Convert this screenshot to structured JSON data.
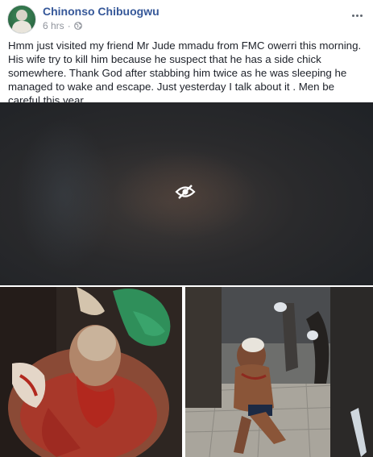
{
  "post": {
    "author": "Chinonso Chibuogwu",
    "time": "6 hrs",
    "separator": "·",
    "text": "Hmm just visited my friend Mr Jude mmadu from FMC owerri this morning. His wife try to kill him because he suspect that he has a side chick somewhere. Thank God after stabbing him twice as he was sleeping he managed to wake and escape. Just yesterday I talk about it . Men be careful this year"
  },
  "icons": {
    "privacy": "globe-icon",
    "options": "more-options-icon",
    "hidden_media": "eye-slash-icon"
  },
  "colors": {
    "author_link": "#365899",
    "meta_text": "#90949c",
    "body_text": "#1d2129"
  }
}
